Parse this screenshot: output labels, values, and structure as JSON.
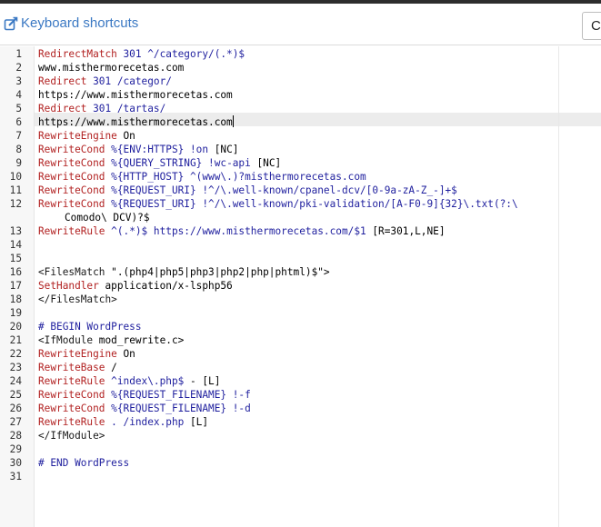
{
  "toolbar": {
    "shortcuts_label": "Keyboard shortcuts",
    "right_button_label": "C"
  },
  "colors": {
    "directive": "#b22222",
    "argument": "#1f1f9e",
    "link": "#3a78c3",
    "active_line": "#ececec"
  },
  "editor": {
    "active_line": 6,
    "lines": [
      {
        "n": "1",
        "parts": [
          [
            "kw",
            "RedirectMatch"
          ],
          [
            "str",
            " 301 ^/category/(.*)$"
          ]
        ]
      },
      {
        "n": "2",
        "parts": [
          [
            "plain",
            "www.misthermorecetas.com"
          ]
        ]
      },
      {
        "n": "3",
        "parts": [
          [
            "kw",
            "Redirect"
          ],
          [
            "str",
            " 301 /categor/"
          ]
        ]
      },
      {
        "n": "4",
        "parts": [
          [
            "plain",
            "https://www.misthermorecetas.com"
          ]
        ]
      },
      {
        "n": "5",
        "parts": [
          [
            "kw",
            "Redirect"
          ],
          [
            "str",
            " 301 /tartas/"
          ]
        ]
      },
      {
        "n": "6",
        "parts": [
          [
            "plain",
            "https://www.misthermorecetas.com"
          ]
        ],
        "cursor": true
      },
      {
        "n": "7",
        "parts": [
          [
            "kw",
            "RewriteEngine"
          ],
          [
            "plain",
            " On"
          ]
        ]
      },
      {
        "n": "8",
        "parts": [
          [
            "kw",
            "RewriteCond"
          ],
          [
            "str",
            " %{ENV:HTTPS} !on"
          ],
          [
            "plain",
            " [NC]"
          ]
        ]
      },
      {
        "n": "9",
        "parts": [
          [
            "kw",
            "RewriteCond"
          ],
          [
            "str",
            " %{QUERY_STRING} !wc-api"
          ],
          [
            "plain",
            " [NC]"
          ]
        ]
      },
      {
        "n": "10",
        "parts": [
          [
            "kw",
            "RewriteCond"
          ],
          [
            "str",
            " %{HTTP_HOST} ^(www\\.)?misthermorecetas.com"
          ]
        ]
      },
      {
        "n": "11",
        "parts": [
          [
            "kw",
            "RewriteCond"
          ],
          [
            "str",
            " %{REQUEST_URI} !^/\\.well-known/cpanel-dcv/[0-9a-zA-Z_-]+$"
          ]
        ]
      },
      {
        "n": "12",
        "parts": [
          [
            "kw",
            "RewriteCond"
          ],
          [
            "str",
            " %{REQUEST_URI} !^/\\.well-known/pki-validation/[A-F0-9]{32}\\.txt(?:\\"
          ]
        ],
        "cont": "Comodo\\ DCV)?$"
      },
      {
        "n": "13",
        "parts": [
          [
            "kw",
            "RewriteRule"
          ],
          [
            "str",
            " ^(.*)$ https://www.misthermorecetas.com/$1"
          ],
          [
            "plain",
            " [R=301,L,NE]"
          ]
        ]
      },
      {
        "n": "14",
        "parts": []
      },
      {
        "n": "15",
        "parts": []
      },
      {
        "n": "16",
        "parts": [
          [
            "tag",
            "<FilesMatch "
          ],
          [
            "plain",
            "\".(php4|php5|php3|php2|php|phtml)$\">"
          ]
        ]
      },
      {
        "n": "17",
        "parts": [
          [
            "kw",
            "SetHandler"
          ],
          [
            "plain",
            " application/x-lsphp56"
          ]
        ]
      },
      {
        "n": "18",
        "parts": [
          [
            "tag",
            "</FilesMatch>"
          ]
        ]
      },
      {
        "n": "19",
        "parts": []
      },
      {
        "n": "20",
        "parts": [
          [
            "cmt",
            "# BEGIN WordPress"
          ]
        ]
      },
      {
        "n": "21",
        "parts": [
          [
            "tag",
            "<IfModule "
          ],
          [
            "plain",
            "mod_rewrite.c>"
          ]
        ]
      },
      {
        "n": "22",
        "parts": [
          [
            "kw",
            "RewriteEngine"
          ],
          [
            "plain",
            " On"
          ]
        ]
      },
      {
        "n": "23",
        "parts": [
          [
            "kw",
            "RewriteBase"
          ],
          [
            "plain",
            " /"
          ]
        ]
      },
      {
        "n": "24",
        "parts": [
          [
            "kw",
            "RewriteRule"
          ],
          [
            "str",
            " ^index\\.php$"
          ],
          [
            "plain",
            " - [L]"
          ]
        ]
      },
      {
        "n": "25",
        "parts": [
          [
            "kw",
            "RewriteCond"
          ],
          [
            "str",
            " %{REQUEST_FILENAME} !-f"
          ]
        ]
      },
      {
        "n": "26",
        "parts": [
          [
            "kw",
            "RewriteCond"
          ],
          [
            "str",
            " %{REQUEST_FILENAME} !-d"
          ]
        ]
      },
      {
        "n": "27",
        "parts": [
          [
            "kw",
            "RewriteRule"
          ],
          [
            "str",
            " . /index.php"
          ],
          [
            "plain",
            " [L]"
          ]
        ]
      },
      {
        "n": "28",
        "parts": [
          [
            "tag",
            "</IfModule>"
          ]
        ]
      },
      {
        "n": "29",
        "parts": []
      },
      {
        "n": "30",
        "parts": [
          [
            "cmt",
            "# END WordPress"
          ]
        ]
      },
      {
        "n": "31",
        "parts": []
      }
    ]
  }
}
